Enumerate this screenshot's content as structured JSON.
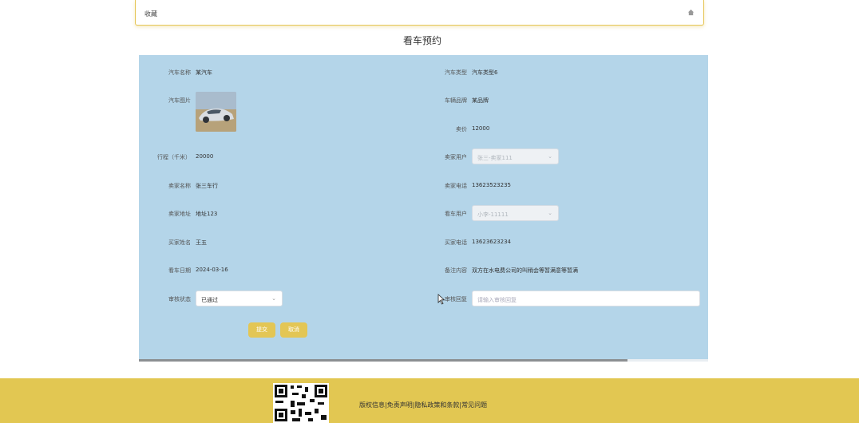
{
  "topbar": {
    "favorites_label": "收藏"
  },
  "page_title": "看车预约",
  "form": {
    "car_name_label": "汽车名称",
    "car_name_value": "某汽车",
    "car_type_label": "汽车类型",
    "car_type_value": "汽车类型6",
    "car_image_label": "汽车图片",
    "brand_label": "车辆品牌",
    "brand_value": "某品牌",
    "price_label": "卖价",
    "price_value": "12000",
    "mileage_label": "行程（千米）",
    "mileage_value": "20000",
    "seller_user_label": "卖家用户",
    "seller_user_value": "张三-卖家111",
    "seller_name_label": "卖家名称",
    "seller_name_value": "张三车行",
    "seller_phone_label": "卖家电话",
    "seller_phone_value": "13623523235",
    "seller_address_label": "卖家地址",
    "seller_address_value": "地址123",
    "viewer_user_label": "看车用户",
    "viewer_user_value": "小李-11111",
    "buyer_name_label": "买家姓名",
    "buyer_name_value": "王五",
    "buyer_phone_label": "买家电话",
    "buyer_phone_value": "13623623234",
    "view_date_label": "看车日期",
    "view_date_value": "2024-03-16",
    "remark_label": "备注内容",
    "remark_value": "双方在水电费公司的叫稍会等暂满意等暂满",
    "review_status_label": "审核状态",
    "review_status_value": "已通过",
    "review_reply_label": "审核回复",
    "review_reply_placeholder": "请输入审核回复",
    "submit_label": "提交",
    "cancel_label": "取消"
  },
  "footer": {
    "links_text": "版权信息|免责声明|隐私政策和条款|常见问题"
  },
  "colors": {
    "accent": "#e3c655",
    "panel_bg": "#b4d5e9",
    "footer_bg": "#e2c752"
  },
  "icons": {
    "home": "home-icon",
    "chevron": "chevron-down-icon",
    "cursor": "mouse-cursor-icon",
    "qr": "qr-code"
  }
}
